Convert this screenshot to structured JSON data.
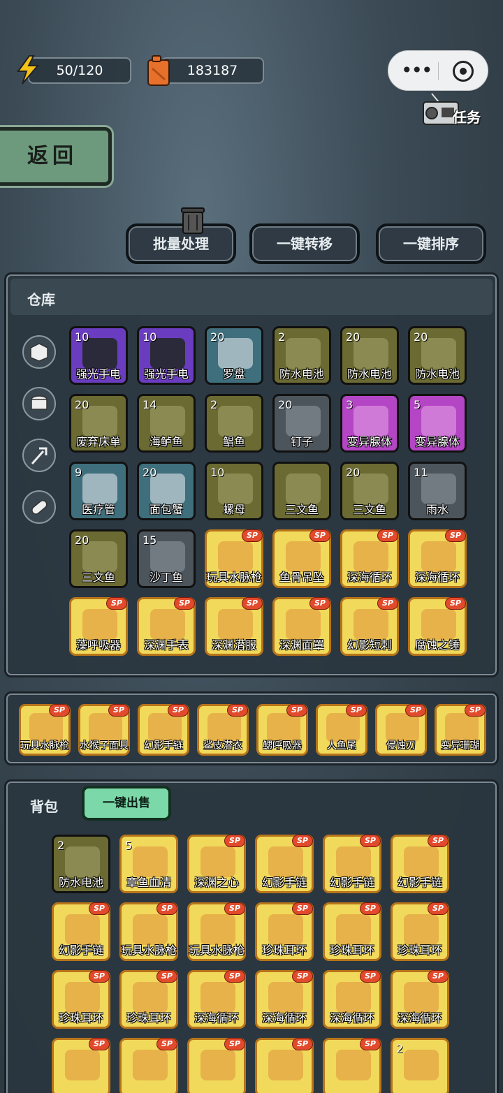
{
  "energy": {
    "value": "50/120"
  },
  "fuel": {
    "value": "183187"
  },
  "task_label": "任务",
  "back_label": "返回",
  "actions": [
    "批量处理",
    "一键转移",
    "一键排序"
  ],
  "warehouse": {
    "title": "仓库",
    "side_icons": [
      "box-icon",
      "can-icon",
      "trident-icon",
      "pill-icon"
    ],
    "items": [
      {
        "name": "强光手电",
        "count": "10",
        "rarity": "purple",
        "sp": false
      },
      {
        "name": "强光手电",
        "count": "10",
        "rarity": "purple",
        "sp": false
      },
      {
        "name": "罗盘",
        "count": "20",
        "rarity": "teal",
        "sp": false
      },
      {
        "name": "防水电池",
        "count": "2",
        "rarity": "olive",
        "sp": false
      },
      {
        "name": "防水电池",
        "count": "20",
        "rarity": "olive",
        "sp": false
      },
      {
        "name": "防水电池",
        "count": "20",
        "rarity": "olive",
        "sp": false
      },
      {
        "name": "废弃床单",
        "count": "20",
        "rarity": "olive",
        "sp": false
      },
      {
        "name": "海鲈鱼",
        "count": "14",
        "rarity": "olive",
        "sp": false
      },
      {
        "name": "鲳鱼",
        "count": "2",
        "rarity": "olive",
        "sp": false
      },
      {
        "name": "钉子",
        "count": "20",
        "rarity": "gray",
        "sp": false
      },
      {
        "name": "变异腺体",
        "count": "3",
        "rarity": "magenta",
        "sp": false
      },
      {
        "name": "变异腺体",
        "count": "5",
        "rarity": "magenta",
        "sp": false
      },
      {
        "name": "医疗管",
        "count": "9",
        "rarity": "teal",
        "sp": false
      },
      {
        "name": "面包蟹",
        "count": "20",
        "rarity": "teal",
        "sp": false
      },
      {
        "name": "螺母",
        "count": "10",
        "rarity": "olive",
        "sp": false
      },
      {
        "name": "三文鱼",
        "count": "",
        "rarity": "olive",
        "sp": false
      },
      {
        "name": "三文鱼",
        "count": "20",
        "rarity": "olive",
        "sp": false
      },
      {
        "name": "雨水",
        "count": "11",
        "rarity": "gray",
        "sp": false
      },
      {
        "name": "三文鱼",
        "count": "20",
        "rarity": "olive",
        "sp": false
      },
      {
        "name": "沙丁鱼",
        "count": "15",
        "rarity": "gray",
        "sp": false
      },
      {
        "name": "玩具水脉枪",
        "count": "",
        "rarity": "yellow",
        "sp": true
      },
      {
        "name": "鱼骨吊坠",
        "count": "",
        "rarity": "yellow",
        "sp": true
      },
      {
        "name": "深海循环",
        "count": "",
        "rarity": "yellow",
        "sp": true
      },
      {
        "name": "深海循环",
        "count": "",
        "rarity": "yellow",
        "sp": true
      },
      {
        "name": "藻呼吸器",
        "count": "",
        "rarity": "yellow",
        "sp": true
      },
      {
        "name": "深渊手表",
        "count": "",
        "rarity": "yellow",
        "sp": true
      },
      {
        "name": "深渊潜服",
        "count": "",
        "rarity": "yellow",
        "sp": true
      },
      {
        "name": "深渊面罩",
        "count": "",
        "rarity": "yellow",
        "sp": true
      },
      {
        "name": "幻影短刺",
        "count": "",
        "rarity": "yellow",
        "sp": true
      },
      {
        "name": "腐蚀之锤",
        "count": "",
        "rarity": "yellow",
        "sp": true
      }
    ]
  },
  "equipped": [
    "玩具水脉枪",
    "水猴子面具",
    "幻影手链",
    "鲨皮潜衣",
    "鳃呼吸器",
    "人鱼尾",
    "侵蚀刃",
    "变异珊瑚"
  ],
  "backpack": {
    "title": "背包",
    "sell_all": "一键出售",
    "items": [
      {
        "name": "防水电池",
        "count": "2",
        "rarity": "olive",
        "sp": false
      },
      {
        "name": "章鱼血清",
        "count": "5",
        "rarity": "yellow",
        "sp": false
      },
      {
        "name": "深渊之心",
        "count": "",
        "rarity": "yellow",
        "sp": true
      },
      {
        "name": "幻影手链",
        "count": "",
        "rarity": "yellow",
        "sp": true
      },
      {
        "name": "幻影手链",
        "count": "",
        "rarity": "yellow",
        "sp": true
      },
      {
        "name": "幻影手链",
        "count": "",
        "rarity": "yellow",
        "sp": true
      },
      {
        "name": "幻影手链",
        "count": "",
        "rarity": "yellow",
        "sp": true
      },
      {
        "name": "玩具水脉枪",
        "count": "",
        "rarity": "yellow",
        "sp": true
      },
      {
        "name": "玩具水脉枪",
        "count": "",
        "rarity": "yellow",
        "sp": true
      },
      {
        "name": "珍珠耳环",
        "count": "",
        "rarity": "yellow",
        "sp": true
      },
      {
        "name": "珍珠耳环",
        "count": "",
        "rarity": "yellow",
        "sp": true
      },
      {
        "name": "珍珠耳环",
        "count": "",
        "rarity": "yellow",
        "sp": true
      },
      {
        "name": "珍珠耳环",
        "count": "",
        "rarity": "yellow",
        "sp": true
      },
      {
        "name": "珍珠耳环",
        "count": "",
        "rarity": "yellow",
        "sp": true
      },
      {
        "name": "深海循环",
        "count": "",
        "rarity": "yellow",
        "sp": true
      },
      {
        "name": "深海循环",
        "count": "",
        "rarity": "yellow",
        "sp": true
      },
      {
        "name": "深海循环",
        "count": "",
        "rarity": "yellow",
        "sp": true
      },
      {
        "name": "深海循环",
        "count": "",
        "rarity": "yellow",
        "sp": true
      },
      {
        "name": "",
        "count": "",
        "rarity": "yellow",
        "sp": true
      },
      {
        "name": "",
        "count": "",
        "rarity": "yellow",
        "sp": true
      },
      {
        "name": "",
        "count": "",
        "rarity": "yellow",
        "sp": true
      },
      {
        "name": "",
        "count": "",
        "rarity": "yellow",
        "sp": true
      },
      {
        "name": "",
        "count": "",
        "rarity": "yellow",
        "sp": true
      },
      {
        "name": "",
        "count": "2",
        "rarity": "yellow",
        "sp": false
      }
    ]
  },
  "sp_label": "SP"
}
